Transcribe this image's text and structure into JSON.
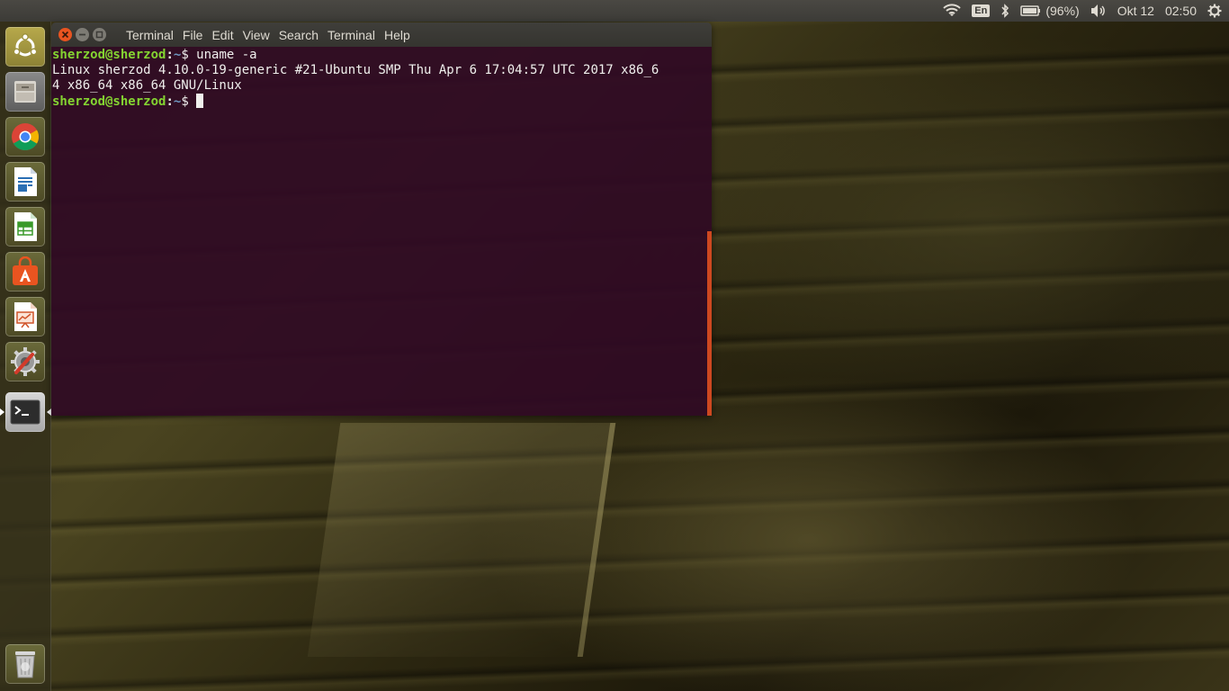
{
  "top_panel": {
    "language": "En",
    "battery": "(96%)",
    "date": "Okt 12",
    "time": "02:50"
  },
  "launcher": {
    "items": [
      {
        "name": "ubuntu-dash"
      },
      {
        "name": "files"
      },
      {
        "name": "chrome"
      },
      {
        "name": "writer"
      },
      {
        "name": "calc"
      },
      {
        "name": "software-center"
      },
      {
        "name": "impress"
      },
      {
        "name": "system-settings"
      },
      {
        "name": "terminal",
        "active": true
      },
      {
        "name": "trash"
      }
    ]
  },
  "terminal_window": {
    "title": "Terminal",
    "menus": [
      "File",
      "Edit",
      "View",
      "Search",
      "Terminal",
      "Help"
    ],
    "lines": [
      {
        "user_host": "sherzod@sherzod",
        "path": "~",
        "symbol": "$",
        "command": " uname -a"
      },
      {
        "output": "Linux sherzod 4.10.0-19-generic #21-Ubuntu SMP Thu Apr 6 17:04:57 UTC 2017 x86_6"
      },
      {
        "output": "4 x86_64 x86_64 GNU/Linux"
      },
      {
        "user_host": "sherzod@sherzod",
        "path": "~",
        "symbol": "$",
        "command": " "
      }
    ]
  },
  "colors": {
    "terminal_bg": "#300a24",
    "prompt_user": "#8ae234",
    "prompt_path": "#729fcf",
    "accent": "#e95420",
    "panel_bg": "#3c3b37"
  }
}
